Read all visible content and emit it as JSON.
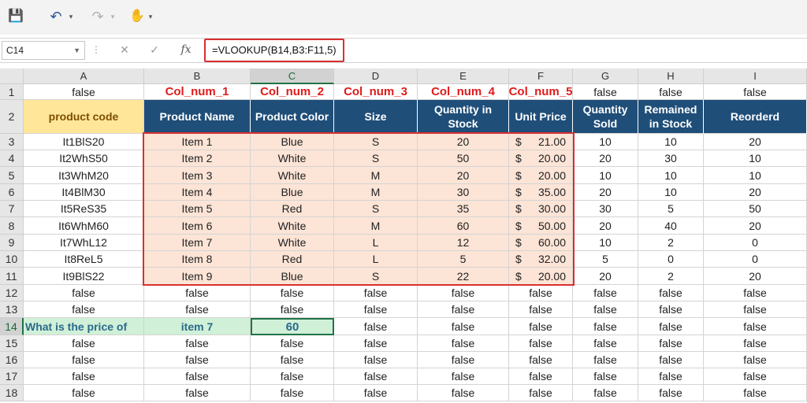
{
  "formula_bar": {
    "name_box": "C14",
    "formula": "=VLOOKUP(B14,B3:F11,5)"
  },
  "columns": [
    "A",
    "B",
    "C",
    "D",
    "E",
    "F",
    "G",
    "H",
    "I"
  ],
  "rows": [
    "1",
    "2",
    "3",
    "4",
    "5",
    "6",
    "7",
    "8",
    "9",
    "10",
    "11",
    "12",
    "13",
    "14",
    "15",
    "16",
    "17",
    "18"
  ],
  "col_num_labels": [
    "Col_num_1",
    "Col_num_2",
    "Col_num_3",
    "Col_num_4",
    "Col_num_5"
  ],
  "table": {
    "headers": [
      "product code",
      "Product Name",
      "Product Color",
      "Size",
      "Quantity in Stock",
      "Unit Price",
      "Quantity Sold",
      "Remained in Stock",
      "Reorderd"
    ],
    "rows": [
      [
        "It1BlS20",
        "Item 1",
        "Blue",
        "S",
        "20",
        "$",
        "21.00",
        "10",
        "10",
        "20"
      ],
      [
        "It2WhS50",
        "Item 2",
        "White",
        "S",
        "50",
        "$",
        "20.00",
        "20",
        "30",
        "10"
      ],
      [
        "It3WhM20",
        "Item 3",
        "White",
        "M",
        "20",
        "$",
        "20.00",
        "10",
        "10",
        "10"
      ],
      [
        "It4BlM30",
        "Item 4",
        "Blue",
        "M",
        "30",
        "$",
        "35.00",
        "20",
        "10",
        "20"
      ],
      [
        "It5ReS35",
        "Item 5",
        "Red",
        "S",
        "35",
        "$",
        "30.00",
        "30",
        "5",
        "50"
      ],
      [
        "It6WhM60",
        "Item 6",
        "White",
        "M",
        "60",
        "$",
        "50.00",
        "20",
        "40",
        "20"
      ],
      [
        "It7WhL12",
        "Item 7",
        "White",
        "L",
        "12",
        "$",
        "60.00",
        "10",
        "2",
        "0"
      ],
      [
        "It8ReL5",
        "Item 8",
        "Red",
        "L",
        "5",
        "$",
        "32.00",
        "5",
        "0",
        "0"
      ],
      [
        "It9BlS22",
        "Item 9",
        "Blue",
        "S",
        "22",
        "$",
        "20.00",
        "20",
        "2",
        "20"
      ]
    ]
  },
  "query": {
    "question": "What is the price of",
    "lookup_value": "item 7",
    "result": "60"
  },
  "colors": {
    "header_blue": "#1f4e79",
    "product_code_yellow": "#ffe699",
    "table_peach": "#fce4d6",
    "query_green": "#d0f0d8",
    "highlight_red": "#d9302f"
  }
}
